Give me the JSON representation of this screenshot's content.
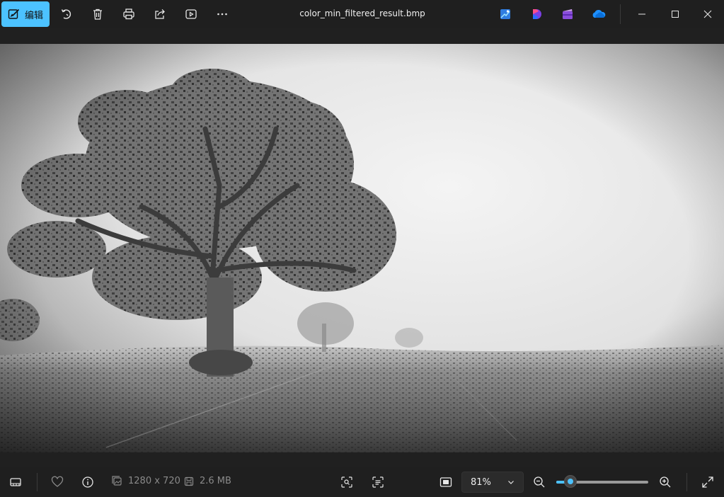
{
  "toolbar": {
    "edit_label": "编辑",
    "file_name": "color_min_filtered_result.bmp",
    "icons": [
      "edit-icon",
      "rotate-icon",
      "delete-icon",
      "print-icon",
      "share-icon",
      "slideshow-icon",
      "more-icon"
    ],
    "apps": [
      "designer-app-icon",
      "clipchamp-icon",
      "video-editor-icon",
      "onedrive-icon"
    ]
  },
  "window": {
    "controls": [
      "minimize",
      "maximize",
      "close"
    ]
  },
  "image": {
    "description_name": "grayscale-tree-in-fog"
  },
  "status": {
    "dimensions": "1280 x 720",
    "file_size": "2.6 MB",
    "zoom_label": "81%",
    "zoom_fraction": 0.15
  },
  "colors": {
    "accent": "#4cc2ff",
    "background": "#1c1c1c",
    "bar": "#1f1f1f"
  }
}
